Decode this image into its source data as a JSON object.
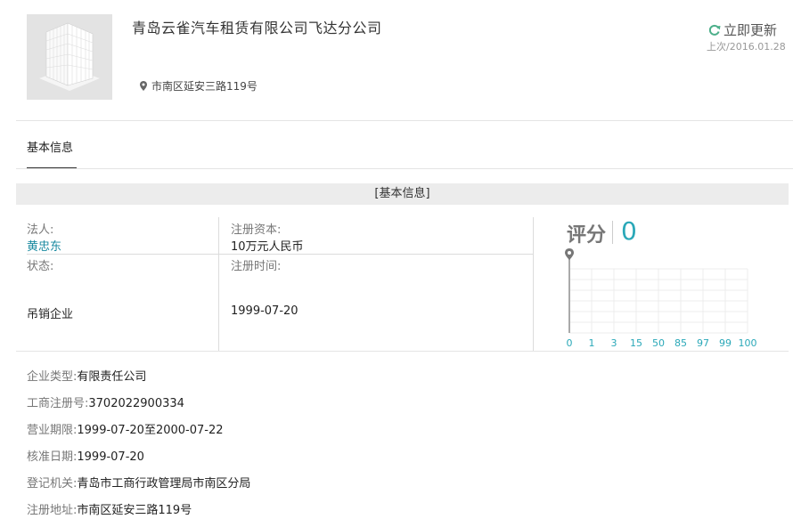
{
  "header": {
    "company_name": "青岛云雀汽车租赁有限公司飞达分公司",
    "address": "市南区延安三路119号",
    "refresh_label": "立即更新",
    "last_update": "上次/2016.01.28"
  },
  "tabs": [
    {
      "label": "基本信息"
    }
  ],
  "section": {
    "title": "[基本信息]"
  },
  "grid": {
    "legal_label": "法人:",
    "legal_value": "黄忠东",
    "capital_label": "注册资本:",
    "capital_value": "10万元人民币",
    "status_label": "状态:",
    "status_value": "吊销企业",
    "reg_time_label": "注册时间:",
    "reg_time_value": "1999-07-20"
  },
  "score": {
    "label": "评分",
    "value": "0",
    "ticks": [
      "0",
      "1",
      "3",
      "15",
      "50",
      "85",
      "97",
      "99",
      "100"
    ]
  },
  "details": [
    {
      "label": "企业类型:",
      "value": "有限责任公司"
    },
    {
      "label": "工商注册号:",
      "value": "3702022900334"
    },
    {
      "label": "营业期限:",
      "value": "1999-07-20至2000-07-22"
    },
    {
      "label": "核准日期:",
      "value": "1999-07-20"
    },
    {
      "label": "登记机关:",
      "value": "青岛市工商行政管理局市南区分局"
    },
    {
      "label": "注册地址:",
      "value": "市南区延安三路119号"
    }
  ],
  "colors": {
    "accent": "#2aa8b8",
    "link": "#1a8aa0"
  }
}
